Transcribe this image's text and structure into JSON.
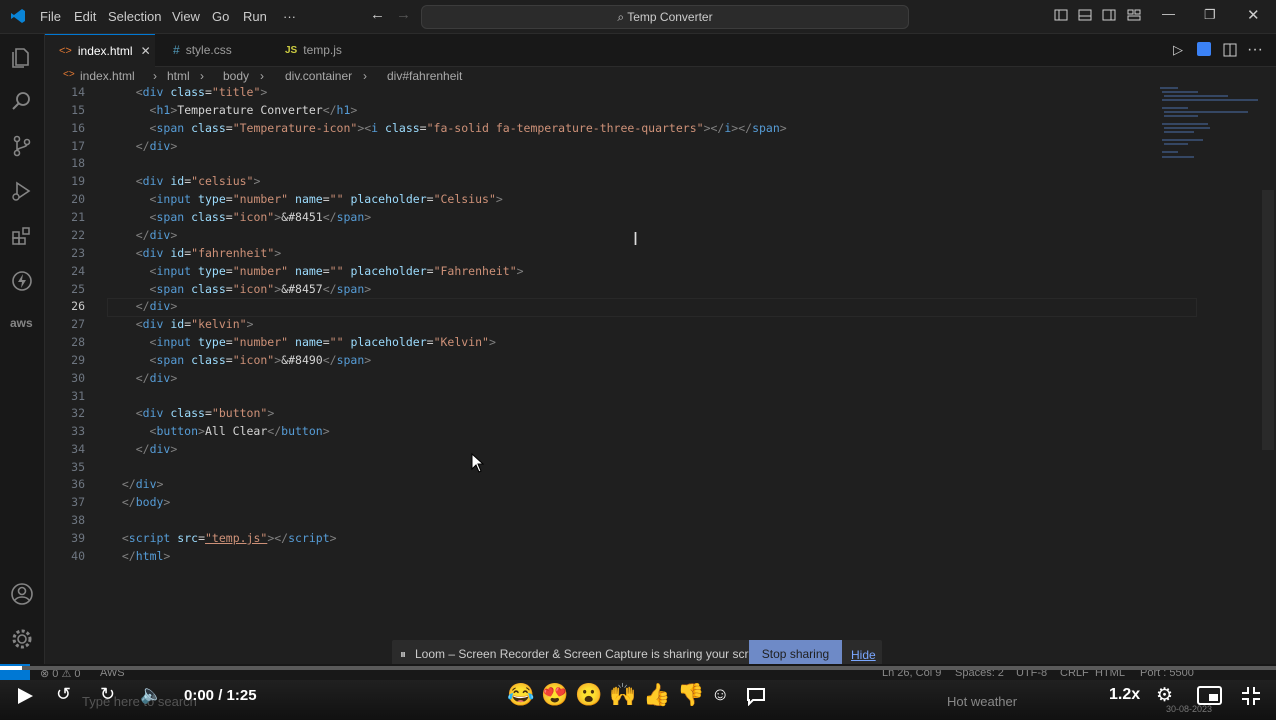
{
  "menu": [
    "File",
    "Edit",
    "Selection",
    "View",
    "Go",
    "Run",
    "···"
  ],
  "search": {
    "label": "Temp Converter"
  },
  "tabs": [
    {
      "label": "index.html",
      "icon": "html-icon",
      "active": true
    },
    {
      "label": "style.css",
      "icon": "css-icon",
      "active": false
    },
    {
      "label": "temp.js",
      "icon": "js-icon",
      "active": false
    }
  ],
  "breadcrumb": [
    "index.html",
    "html",
    "body",
    "div.container",
    "div#fahrenheit"
  ],
  "editor": {
    "lines": [
      {
        "n": "14",
        "html": "<span class='br'>&lt;</span><span class='tag'>div</span> <span class='at'>class</span>=<span class='st'>\"title\"</span><span class='br'>&gt;</span>",
        "indent": 1
      },
      {
        "n": "15",
        "indent": 2
      },
      {
        "n": "16",
        "indent": 2
      },
      {
        "n": "17",
        "indent": 1
      },
      {
        "n": "18",
        "indent": 0
      },
      {
        "n": "19",
        "indent": 1
      },
      {
        "n": "20",
        "indent": 2
      },
      {
        "n": "21",
        "indent": 2
      },
      {
        "n": "22",
        "indent": 1
      },
      {
        "n": "23",
        "indent": 1
      },
      {
        "n": "24",
        "indent": 2
      },
      {
        "n": "25",
        "indent": 2
      },
      {
        "n": "26",
        "indent": 1
      },
      {
        "n": "27",
        "indent": 1
      },
      {
        "n": "28",
        "indent": 2
      },
      {
        "n": "29",
        "indent": 2
      },
      {
        "n": "30",
        "indent": 1
      },
      {
        "n": "31",
        "indent": 0
      },
      {
        "n": "32",
        "indent": 1
      },
      {
        "n": "33",
        "indent": 2
      },
      {
        "n": "34",
        "indent": 1
      },
      {
        "n": "35",
        "indent": 0
      },
      {
        "n": "36",
        "indent": 0
      },
      {
        "n": "37",
        "indent": 0
      },
      {
        "n": "38",
        "indent": 0
      },
      {
        "n": "39",
        "indent": 0
      },
      {
        "n": "40",
        "indent": 0
      }
    ],
    "current_line": "26"
  },
  "code_text": {
    "l14a": "<",
    "l14b": "div",
    "l14c": "class",
    "l14d": "\"title\"",
    "l14e": ">",
    "l15": "Temperature Converter",
    "l16a": "\"Temperature-icon\"",
    "l16b": "\"fa-solid fa-temperature-three-quarters\"",
    "l19": "\"celsius\"",
    "l20": "\"Celsius\"",
    "l21": "&#8451",
    "l23": "\"fahrenheit\"",
    "l24": "\"Fahrenheit\"",
    "l25": "&#8457",
    "l27": "\"kelvin\"",
    "l28": "\"Kelvin\"",
    "l29": "&#8490",
    "l32": "\"button\"",
    "l33": "All Clear",
    "l39": "\"temp.js\""
  },
  "loom": {
    "message": "Loom – Screen Recorder & Screen Capture is sharing your screen.",
    "stop_label": "Stop sharing",
    "hide_label": "Hide"
  },
  "status": {
    "problems": "⊗ 0 ⚠ 0",
    "aws": "AWS",
    "position": "Ln 26, Col 9",
    "spaces": "Spaces: 2",
    "encoding": "UTF-8",
    "eol": "CRLF",
    "language": "HTML",
    "port": "Port : 5500"
  },
  "video": {
    "time": "0:00 / 1:25",
    "speed": "1.2x",
    "progress_fraction": 0.0,
    "emojis": [
      "😂",
      "😍",
      "😮",
      "🙌",
      "👍",
      "👎"
    ]
  },
  "taskbar": {
    "search_placeholder": "Type here to search",
    "weather": "Hot weather",
    "date": "30-08-2023"
  },
  "colors": {
    "accent": "#0078d4",
    "loom_button": "#6e8ac7"
  }
}
